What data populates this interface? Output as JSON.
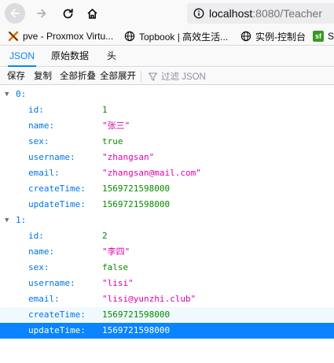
{
  "browser": {
    "url_host": "localhost",
    "url_rest": ":8080/Teacher"
  },
  "bookmarks": [
    {
      "label": "pve - Proxmox Virtu...",
      "icon": "proxmox-icon"
    },
    {
      "label": "Topbook | 高效生活...",
      "icon": "globe-icon"
    },
    {
      "label": "实例-控制台",
      "icon": "globe-icon"
    },
    {
      "label": "S",
      "icon": "sf-icon"
    }
  ],
  "tabs": [
    {
      "label": "JSON",
      "active": true
    },
    {
      "label": "原始数据",
      "active": false
    },
    {
      "label": "头",
      "active": false
    }
  ],
  "toolbar": {
    "save": "保存",
    "copy": "复制",
    "collapse_all": "全部折叠",
    "expand_all": "全部展开",
    "filter_placeholder": "过滤 JSON"
  },
  "records": [
    {
      "index": "0:",
      "fields": [
        {
          "key": "id:",
          "value": "1",
          "type": "num"
        },
        {
          "key": "name:",
          "value": "\"张三\"",
          "type": "str"
        },
        {
          "key": "sex:",
          "value": "true",
          "type": "bool"
        },
        {
          "key": "username:",
          "value": "\"zhangsan\"",
          "type": "str"
        },
        {
          "key": "email:",
          "value": "\"zhangsan@mail.com\"",
          "type": "str"
        },
        {
          "key": "createTime:",
          "value": "1569721598000",
          "type": "num"
        },
        {
          "key": "updateTime:",
          "value": "1569721598000",
          "type": "num"
        }
      ]
    },
    {
      "index": "1:",
      "fields": [
        {
          "key": "id:",
          "value": "2",
          "type": "num"
        },
        {
          "key": "name:",
          "value": "\"李四\"",
          "type": "str"
        },
        {
          "key": "sex:",
          "value": "false",
          "type": "bool"
        },
        {
          "key": "username:",
          "value": "\"lisi\"",
          "type": "str"
        },
        {
          "key": "email:",
          "value": "\"lisi@yunzhi.club\"",
          "type": "str"
        },
        {
          "key": "createTime:",
          "value": "1569721598000",
          "type": "num"
        },
        {
          "key": "updateTime:",
          "value": "1569721598000",
          "type": "num"
        }
      ]
    }
  ],
  "colors": {
    "accent": "#0a84ff",
    "key": "#0074e8",
    "string": "#dd00a9",
    "number": "#058b00"
  }
}
